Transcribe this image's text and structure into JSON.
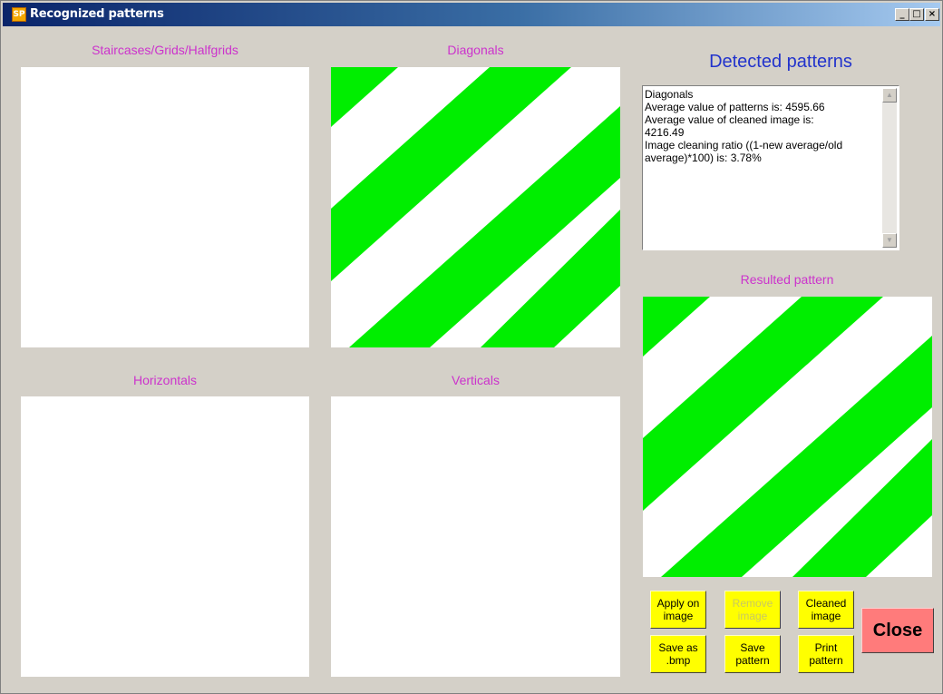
{
  "window": {
    "title": "Recognized patterns",
    "icon_text": "SP",
    "controls": {
      "minimize": "_",
      "maximize": "□",
      "close": "×"
    }
  },
  "panels": {
    "staircases": {
      "title": "Staircases/Grids/Halfgrids"
    },
    "diagonals": {
      "title": "Diagonals"
    },
    "horizontals": {
      "title": "Horizontals"
    },
    "verticals": {
      "title": "Verticals"
    }
  },
  "detected": {
    "title": "Detected patterns",
    "text": "Diagonals\nAverage value of patterns is: 4595.66\nAverage value of cleaned image is:\n4216.49\nImage cleaning ratio ((1-new average/old\naverage)*100) is: 3.78%"
  },
  "resulted": {
    "title": "Resulted pattern"
  },
  "buttons": {
    "apply": "Apply on\nimage",
    "remove": "Remove\nimage",
    "cleaned": "Cleaned\nimage",
    "save_bmp": "Save as\n.bmp",
    "save_pattern": "Save\npattern",
    "print_pattern": "Print\npattern",
    "close": "Close"
  },
  "colors": {
    "stripe": "#00ee00",
    "panel_title": "#cc33cc",
    "detected_title": "#2233cc",
    "button_yellow": "#ffff00",
    "close_red": "#ff7b7b"
  }
}
